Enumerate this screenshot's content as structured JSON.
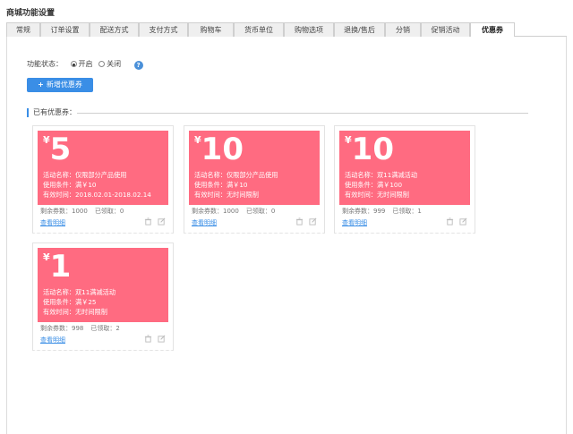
{
  "page": {
    "title": "商城功能设置"
  },
  "tabs": [
    {
      "label": "常规"
    },
    {
      "label": "订单设置"
    },
    {
      "label": "配送方式"
    },
    {
      "label": "支付方式"
    },
    {
      "label": "购物车"
    },
    {
      "label": "货币单位"
    },
    {
      "label": "购物选项"
    },
    {
      "label": "退换/售后"
    },
    {
      "label": "分销"
    },
    {
      "label": "促销活动"
    },
    {
      "label": "优惠券"
    }
  ],
  "active_tab": "优惠券",
  "feature": {
    "label": "功能状态：",
    "options": [
      {
        "label": "开启",
        "checked": true
      },
      {
        "label": "关闭",
        "checked": false
      }
    ],
    "help": "?"
  },
  "add_button": {
    "plus": "+",
    "label": "新增优惠券"
  },
  "section": {
    "title": "已有优惠券："
  },
  "colors": {
    "coupon_bg": "#ff6b81",
    "accent": "#3a8ee6"
  },
  "coupons": [
    {
      "yen": "¥",
      "amount": "5",
      "name": "活动名称：仅限部分产品使用",
      "condition": "使用条件：满￥10",
      "validity": "有效时间：2018.02.01-2018.02.14",
      "remaining": "剩余券数：1000",
      "claimed": "已领取：0",
      "detail": "查看明细"
    },
    {
      "yen": "¥",
      "amount": "10",
      "name": "活动名称：仅限部分产品使用",
      "condition": "使用条件：满￥10",
      "validity": "有效时间：无时间限制",
      "remaining": "剩余券数：1000",
      "claimed": "已领取：0",
      "detail": "查看明细"
    },
    {
      "yen": "¥",
      "amount": "10",
      "name": "活动名称：双11满减活动",
      "condition": "使用条件：满￥100",
      "validity": "有效时间：无时间限制",
      "remaining": "剩余券数：999",
      "claimed": "已领取：1",
      "detail": "查看明细"
    },
    {
      "yen": "¥",
      "amount": "1",
      "name": "活动名称：双11满减活动",
      "condition": "使用条件：满￥25",
      "validity": "有效时间：无时间限制",
      "remaining": "剩余券数：998",
      "claimed": "已领取：2",
      "detail": "查看明细"
    }
  ]
}
